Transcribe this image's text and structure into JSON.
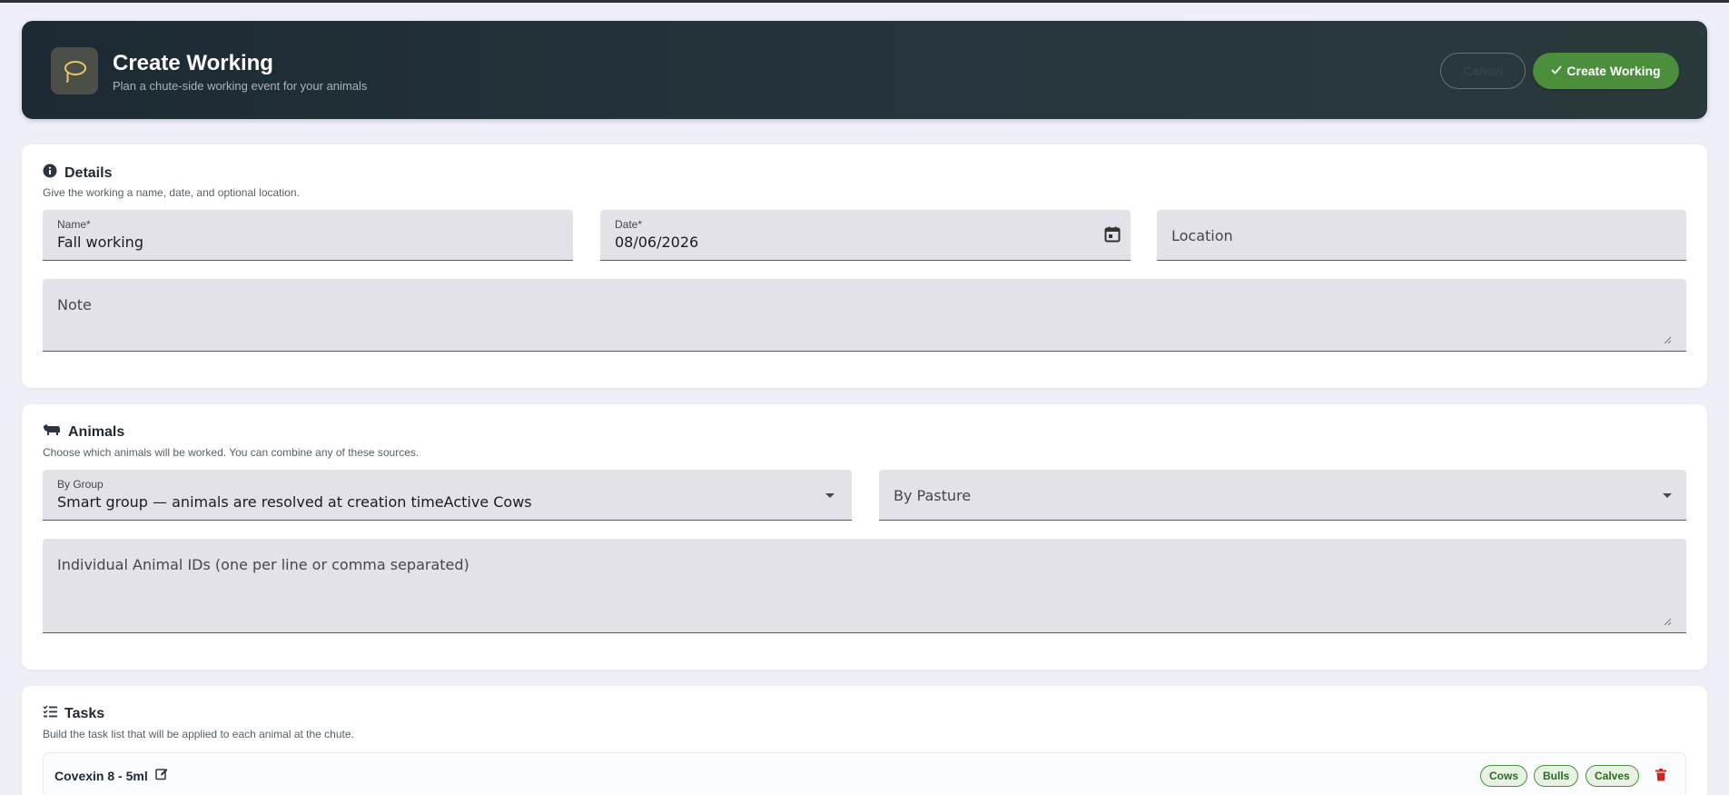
{
  "header": {
    "title": "Create Working",
    "subtitle": "Plan a chute-side working event for your animals",
    "cancel_label": "Cancel",
    "create_label": "Create Working"
  },
  "details": {
    "title": "Details",
    "description": "Give the working a name, date, and optional location.",
    "name_label": "Name*",
    "name_value": "Fall working",
    "date_label": "Date*",
    "date_value": "08/06/2026",
    "location_placeholder": "Location",
    "note_placeholder": "Note"
  },
  "animals": {
    "title": "Animals",
    "description": "Choose which animals will be worked. You can combine any of these sources.",
    "group_label": "By Group",
    "group_value": "Smart group — animals are resolved at creation timeActive Cows",
    "pasture_placeholder": "By Pasture",
    "ids_placeholder": "Individual Animal IDs (one per line or comma separated)"
  },
  "tasks": {
    "title": "Tasks",
    "description": "Build the task list that will be applied to each animal at the chute.",
    "items": [
      {
        "name": "Covexin 8 - 5ml",
        "tags": [
          "Cows",
          "Bulls",
          "Calves"
        ]
      }
    ]
  },
  "colors": {
    "accent": "#4b8f3c",
    "header_bg": "#1d2a33",
    "delete": "#c62828"
  }
}
